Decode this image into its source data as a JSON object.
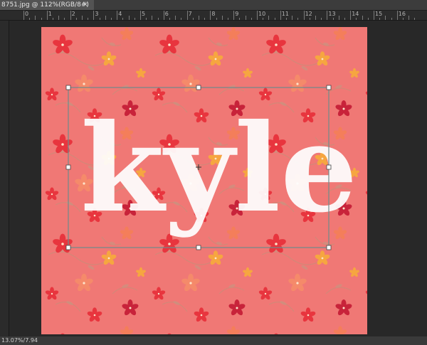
{
  "document_tab": {
    "title": "8751.jpg @ 112%(RGB/8#)",
    "close_glyph": "×"
  },
  "ruler": {
    "labels": [
      "0",
      "1",
      "2",
      "3",
      "4",
      "5",
      "6",
      "7",
      "8",
      "9",
      "10",
      "11",
      "12",
      "13",
      "14",
      "15",
      "16"
    ]
  },
  "canvas": {
    "text_layer": "kyle",
    "background_color": "#f07875",
    "flower_colors": [
      "#e8353e",
      "#f47e5a",
      "#f6a640",
      "#c8233a"
    ],
    "leaf_color": "#bd8a74"
  },
  "status": {
    "text": "13.07%/7.94"
  }
}
